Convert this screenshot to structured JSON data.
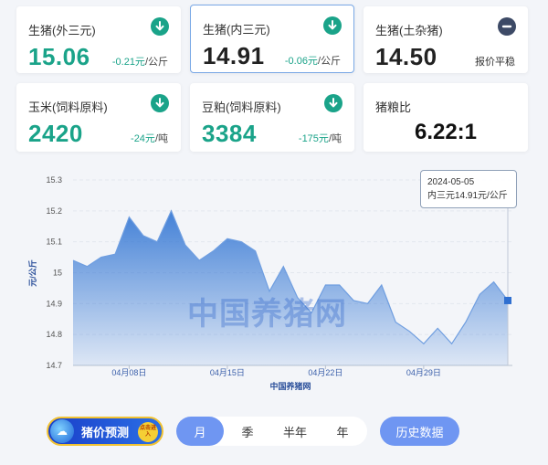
{
  "cards": [
    {
      "name": "生猪(外三元)",
      "price": "15.06",
      "change": "-0.21元",
      "unit": "/公斤",
      "icon": "down-arrow-icon"
    },
    {
      "name": "生猪(内三元)",
      "price": "14.91",
      "change": "-0.06元",
      "unit": "/公斤",
      "icon": "down-arrow-icon"
    },
    {
      "name": "生猪(土杂猪)",
      "price": "14.50",
      "change": "报价平稳",
      "unit": "",
      "icon": "minus-icon"
    },
    {
      "name": "玉米(饲料原料)",
      "price": "2420",
      "change": "-24元",
      "unit": "/吨",
      "icon": "down-arrow-icon"
    },
    {
      "name": "豆粕(饲料原料)",
      "price": "3384",
      "change": "-175元",
      "unit": "/吨",
      "icon": "down-arrow-icon"
    },
    {
      "name": "猪粮比",
      "price": "6.22:1"
    }
  ],
  "colors": {
    "up_down_green": "#1aa389",
    "accent_blue": "#6f96f2",
    "line_blue": "#3a7bd5"
  },
  "chart_data": {
    "type": "area",
    "ylabel": "元/公斤",
    "xlabel": "中国养猪网",
    "ylim": [
      14.7,
      15.3
    ],
    "yticks": [
      "15.3",
      "15.2",
      "15.1",
      "15",
      "14.9",
      "14.8",
      "14.7"
    ],
    "xticks": [
      {
        "label": "04月08日",
        "index": 4
      },
      {
        "label": "04月15日",
        "index": 11
      },
      {
        "label": "04月22日",
        "index": 18
      },
      {
        "label": "04月29日",
        "index": 25
      }
    ],
    "x": [
      "04-04",
      "04-05",
      "04-06",
      "04-07",
      "04-08",
      "04-09",
      "04-10",
      "04-11",
      "04-12",
      "04-13",
      "04-14",
      "04-15",
      "04-16",
      "04-17",
      "04-18",
      "04-19",
      "04-20",
      "04-21",
      "04-22",
      "04-23",
      "04-24",
      "04-25",
      "04-26",
      "04-27",
      "04-28",
      "04-29",
      "04-30",
      "05-01",
      "05-02",
      "05-03",
      "05-04",
      "05-05"
    ],
    "values": [
      15.04,
      15.02,
      15.05,
      15.06,
      15.18,
      15.12,
      15.1,
      15.2,
      15.09,
      15.04,
      15.07,
      15.11,
      15.1,
      15.07,
      14.94,
      15.02,
      14.92,
      14.87,
      14.96,
      14.96,
      14.91,
      14.9,
      14.96,
      14.84,
      14.81,
      14.77,
      14.82,
      14.77,
      14.84,
      14.93,
      14.97,
      14.91
    ],
    "grid": true,
    "tooltip": {
      "date": "2024-05-05",
      "text": "内三元14.91元/公斤"
    }
  },
  "watermark": "中国养猪网",
  "promo": {
    "label": "猪价预测",
    "tag": "点击进入"
  },
  "periods": [
    {
      "label": "月"
    },
    {
      "label": "季"
    },
    {
      "label": "半年"
    },
    {
      "label": "年"
    }
  ],
  "history_label": "历史数据"
}
